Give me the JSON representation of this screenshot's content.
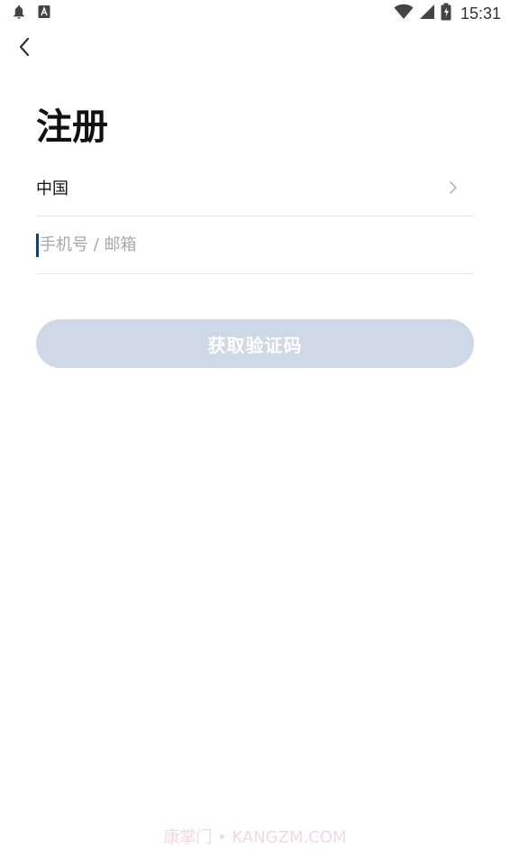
{
  "status_bar": {
    "time": "15:31",
    "icons": [
      "notification-bell-icon",
      "app-notification-icon",
      "wifi-icon",
      "cell-signal-icon",
      "battery-charging-icon"
    ]
  },
  "header": {
    "back_icon": "chevron-left-icon"
  },
  "page": {
    "title": "注册"
  },
  "form": {
    "country": {
      "label": "中国",
      "icon": "chevron-right-icon"
    },
    "account": {
      "value": "",
      "placeholder": "手机号 / 邮箱"
    },
    "submit_label": "获取验证码"
  },
  "colors": {
    "button_disabled_bg": "#ced8e6",
    "cursor": "#1b3c73",
    "title": "#111111"
  },
  "watermark": "康掌门 • KANGZM.COM"
}
